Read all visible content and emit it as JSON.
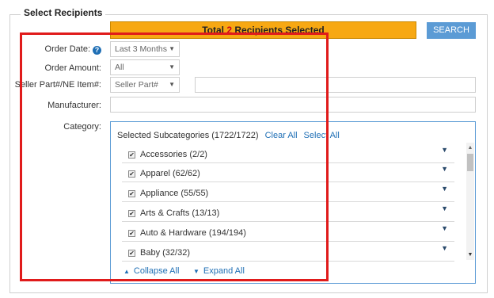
{
  "legend": "Select Recipients",
  "total": {
    "prefix": "Total ",
    "count": "2",
    "suffix": " Recipients Selected"
  },
  "search_label": "SEARCH",
  "fields": {
    "order_date_label": "Order Date:",
    "order_date_value": "Last 3 Months",
    "order_amount_label": "Order Amount:",
    "order_amount_value": "All",
    "seller_part_label": "Seller Part#/NE Item#:",
    "seller_part_value": "Seller Part#",
    "manufacturer_label": "Manufacturer:",
    "category_label": "Category:"
  },
  "category": {
    "heading": "Selected Subcategories (1722/1722)",
    "clear_all": "Clear All",
    "select_all": "Select All",
    "items": [
      {
        "label": "Accessories (2/2)"
      },
      {
        "label": "Apparel (62/62)"
      },
      {
        "label": "Appliance (55/55)"
      },
      {
        "label": "Arts & Crafts (13/13)"
      },
      {
        "label": "Auto & Hardware (194/194)"
      },
      {
        "label": "Baby (32/32)"
      }
    ],
    "collapse_all": "Collapse All",
    "expand_all": "Expand All"
  },
  "icons": {
    "help": "help-circle-icon",
    "caret": "caret-down-icon",
    "checkbox": "checkbox-checked-icon"
  },
  "colors": {
    "total_bar": "#f7a813",
    "count_highlight": "#d0021b",
    "search_button": "#5b9bd5",
    "link": "#1f6fb5",
    "annotation": "#e01b1b"
  }
}
